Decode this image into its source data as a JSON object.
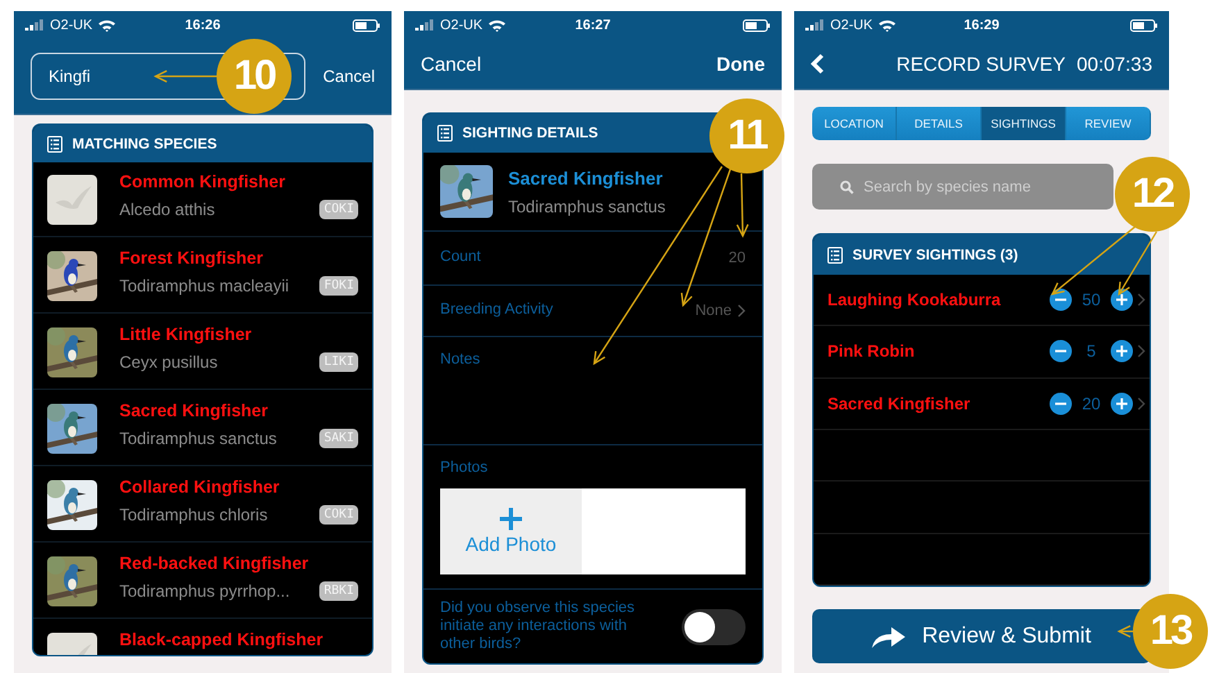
{
  "search_screen": {
    "status": {
      "carrier": "O2-UK",
      "time": "16:26"
    },
    "search": {
      "value": "Kingfi"
    },
    "cancel": "Cancel",
    "list_title": "MATCHING SPECIES",
    "species": [
      {
        "kind": "placeholder",
        "name": "Common Kingfisher",
        "scientific": "Alcedo atthis",
        "code": "COKI"
      },
      {
        "kind": "picture",
        "name": "Forest Kingfisher",
        "scientific": "Todiramphus macleayii",
        "code": "FOKI"
      },
      {
        "kind": "picture",
        "name": "Little Kingfisher",
        "scientific": "Ceyx pusillus",
        "code": "LIKI"
      },
      {
        "kind": "picture",
        "name": "Sacred Kingfisher",
        "scientific": "Todiramphus sanctus",
        "code": "SAKI"
      },
      {
        "kind": "picture",
        "name": "Collared Kingfisher",
        "scientific": "Todiramphus chloris",
        "code": "COKI"
      },
      {
        "kind": "picture",
        "name": "Red-backed Kingfisher",
        "scientific": "Todiramphus pyrrhop...",
        "code": "RBKI"
      },
      {
        "kind": "placeholder",
        "name": "Black-capped Kingfisher"
      }
    ]
  },
  "sighting_screen": {
    "status": {
      "carrier": "O2-UK",
      "time": "16:27"
    },
    "cancel": "Cancel",
    "done": "Done",
    "card_title": "SIGHTING DETAILS",
    "species": {
      "name": "Sacred Kingfisher",
      "scientific": "Todiramphus sanctus"
    },
    "fields": [
      {
        "kind": "value",
        "label": "Count",
        "value": "20"
      },
      {
        "kind": "select",
        "label": "Breeding Activity",
        "value": "None"
      },
      {
        "kind": "notes",
        "label": "Notes"
      },
      {
        "kind": "photos",
        "label": "Photos",
        "button": "Add Photo"
      },
      {
        "kind": "toggle",
        "label": "Did you observe this species initiate any interactions with other birds?",
        "on": false
      }
    ]
  },
  "survey_screen": {
    "status": {
      "carrier": "O2-UK",
      "time": "16:29"
    },
    "title": "RECORD SURVEY",
    "timer": "00:07:33",
    "tabs": [
      {
        "label": "LOCATION",
        "selected": false
      },
      {
        "label": "DETAILS",
        "selected": false
      },
      {
        "label": "SIGHTINGS",
        "selected": true
      },
      {
        "label": "REVIEW",
        "selected": false
      }
    ],
    "search": {
      "placeholder": "Search by species name"
    },
    "card_title": "SURVEY SIGHTINGS (3)",
    "sightings": [
      {
        "name": "Laughing Kookaburra",
        "count": "50"
      },
      {
        "name": "Pink Robin",
        "count": "5"
      },
      {
        "name": "Sacred Kingfisher",
        "count": "20"
      }
    ],
    "submit": "Review & Submit"
  },
  "callouts": [
    {
      "label": "10"
    },
    {
      "label": "11"
    },
    {
      "label": "12"
    },
    {
      "label": "13"
    }
  ]
}
